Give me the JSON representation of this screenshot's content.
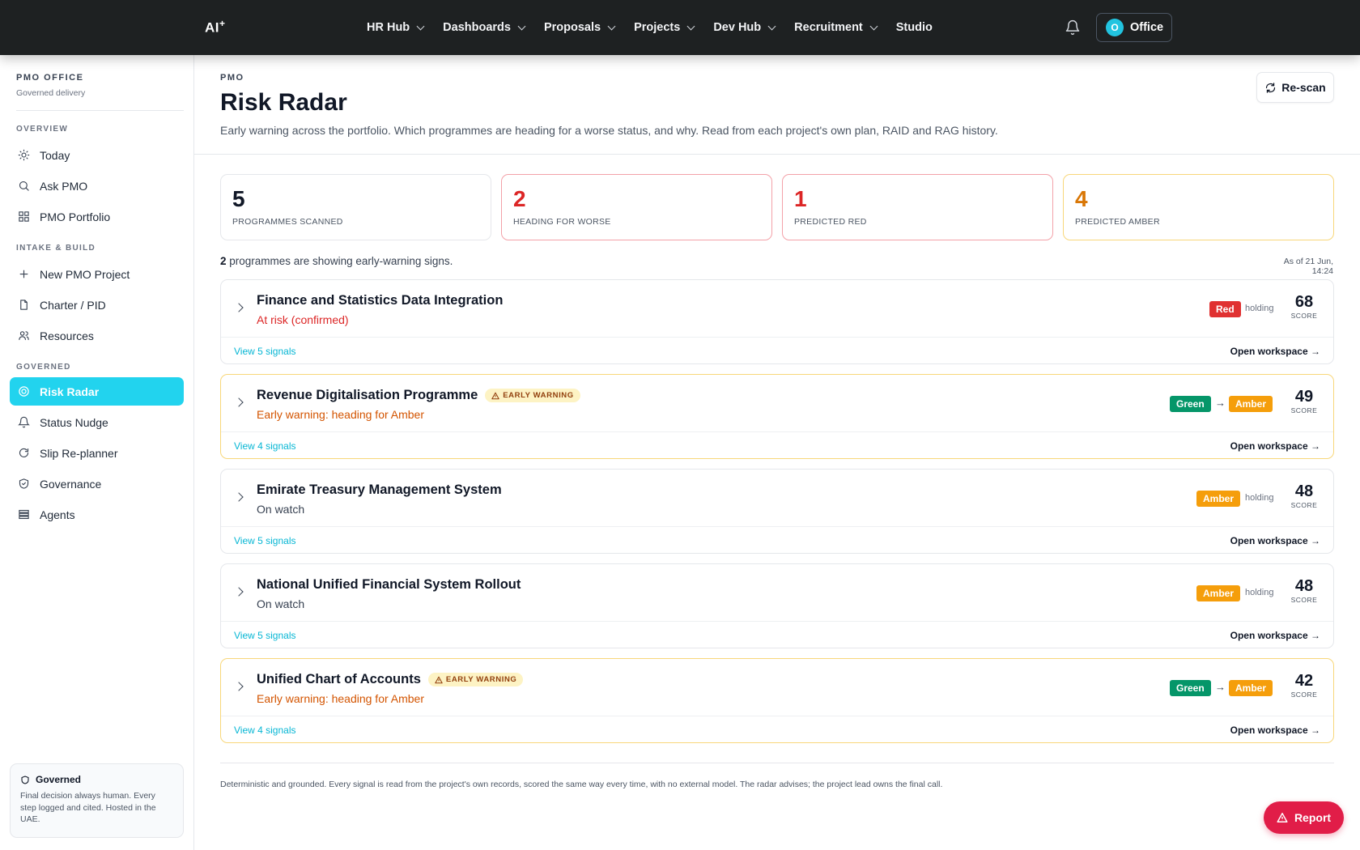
{
  "app": {
    "logo": "AI",
    "logo_sup": "+"
  },
  "nav": [
    {
      "label": "HR Hub",
      "dropdown": true
    },
    {
      "label": "Dashboards",
      "dropdown": true
    },
    {
      "label": "Proposals",
      "dropdown": true
    },
    {
      "label": "Projects",
      "dropdown": true
    },
    {
      "label": "Dev Hub",
      "dropdown": true
    },
    {
      "label": "Recruitment",
      "dropdown": true
    },
    {
      "label": "Studio",
      "dropdown": false
    }
  ],
  "user": {
    "initial": "O",
    "label": "Office"
  },
  "sidebar": {
    "office_title": "PMO OFFICE",
    "office_sub": "Governed delivery",
    "sections": {
      "overview": "OVERVIEW",
      "intake": "INTAKE & BUILD",
      "governed": "GOVERNED"
    },
    "items": [
      {
        "label": "Today",
        "icon": "sun-icon"
      },
      {
        "label": "Ask PMO",
        "icon": "search-icon"
      },
      {
        "label": "PMO Portfolio",
        "icon": "grid-icon"
      },
      {
        "label": "New PMO Project",
        "icon": "plus-icon"
      },
      {
        "label": "Charter / PID",
        "icon": "document-icon"
      },
      {
        "label": "Resources",
        "icon": "users-icon"
      },
      {
        "label": "Risk Radar",
        "icon": "radar-icon",
        "active": true
      },
      {
        "label": "Status Nudge",
        "icon": "bell-icon"
      },
      {
        "label": "Slip Re-planner",
        "icon": "refresh-icon"
      },
      {
        "label": "Governance",
        "icon": "shield-check-icon"
      },
      {
        "label": "Agents",
        "icon": "server-icon"
      }
    ],
    "governed_box": {
      "title": "Governed",
      "text": "Final decision always human. Every step logged and cited. Hosted in the UAE."
    }
  },
  "page": {
    "eyebrow": "PMO",
    "title": "Risk Radar",
    "subtitle": "Early warning across the portfolio. Which programmes are heading for a worse status, and why. Read from each project's own plan, RAID and RAG history.",
    "rescan_label": "Re-scan"
  },
  "stats": [
    {
      "value": "5",
      "label": "PROGRAMMES SCANNED",
      "tone": "neutral"
    },
    {
      "value": "2",
      "label": "HEADING FOR WORSE",
      "tone": "red"
    },
    {
      "value": "1",
      "label": "PREDICTED RED",
      "tone": "red"
    },
    {
      "value": "4",
      "label": "PREDICTED AMBER",
      "tone": "amber"
    }
  ],
  "summary": {
    "count": "2",
    "text": " programmes are showing early-warning signs."
  },
  "as_of": "As of 21 Jun, 14:24",
  "programmes": [
    {
      "name": "Finance and Statistics Data Integration",
      "status": "At risk (confirmed)",
      "status_tone": "red",
      "early_warning": false,
      "from": "Red",
      "to": "",
      "holding": "holding",
      "score": "68",
      "signals": "View 5 signals"
    },
    {
      "name": "Revenue Digitalisation Programme",
      "status": "Early warning: heading for Amber",
      "status_tone": "amber",
      "early_warning": true,
      "from": "Green",
      "to": "Amber",
      "holding": "",
      "score": "49",
      "signals": "View 4 signals"
    },
    {
      "name": "Emirate Treasury Management System",
      "status": "On watch",
      "status_tone": "gray",
      "early_warning": false,
      "from": "Amber",
      "to": "",
      "holding": "holding",
      "score": "48",
      "signals": "View 5 signals"
    },
    {
      "name": "National Unified Financial System Rollout",
      "status": "On watch",
      "status_tone": "gray",
      "early_warning": false,
      "from": "Amber",
      "to": "",
      "holding": "holding",
      "score": "48",
      "signals": "View 5 signals"
    },
    {
      "name": "Unified Chart of Accounts",
      "status": "Early warning: heading for Amber",
      "status_tone": "amber",
      "early_warning": true,
      "from": "Green",
      "to": "Amber",
      "holding": "",
      "score": "42",
      "signals": "View 4 signals"
    }
  ],
  "labels": {
    "early_warning": "EARLY WARNING",
    "score": "SCORE",
    "open_workspace": "Open workspace",
    "arrow_right": "→"
  },
  "footer_note": "Deterministic and grounded. Every signal is read from the project's own records, scored the same way every time, with no external model. The radar advises; the project lead owns the final call.",
  "report_label": "Report",
  "colors": {
    "accent": "#22d3ee",
    "red": "#dc2626",
    "amber": "#f59e0b",
    "green": "#059669",
    "topbar": "#1e2122",
    "report": "#e11d48"
  }
}
